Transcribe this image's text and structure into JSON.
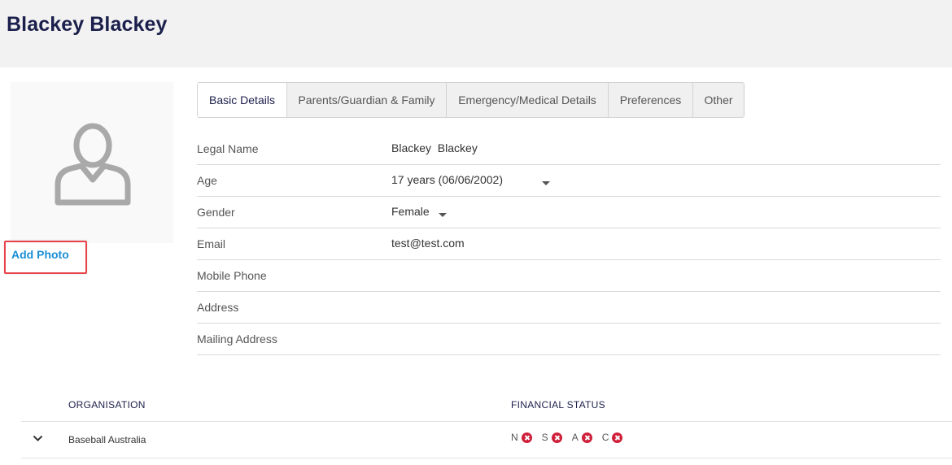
{
  "header": {
    "title": "Blackey Blackey"
  },
  "photo": {
    "add_label": "Add Photo",
    "icon": "user-avatar-icon"
  },
  "tabs": [
    {
      "label": "Basic Details",
      "active": true
    },
    {
      "label": "Parents/Guardian & Family",
      "active": false
    },
    {
      "label": "Emergency/Medical Details",
      "active": false
    },
    {
      "label": "Preferences",
      "active": false
    },
    {
      "label": "Other",
      "active": false
    }
  ],
  "details": [
    {
      "label": "Legal Name",
      "value": "Blackey  Blackey"
    },
    {
      "label": "Age",
      "value": "17 years (06/06/2002)"
    },
    {
      "label": "Gender",
      "value": "Female"
    },
    {
      "label": "Email",
      "value": "test@test.com"
    },
    {
      "label": "Mobile Phone",
      "value": ""
    },
    {
      "label": "Address",
      "value": ""
    },
    {
      "label": "Mailing Address",
      "value": ""
    }
  ],
  "org_table": {
    "headers": {
      "organisation": "ORGANISATION",
      "financial_status": "FINANCIAL STATUS"
    },
    "rows": [
      {
        "organisation": "Baseball Australia",
        "status": [
          {
            "letter": "N",
            "state": "unpaid"
          },
          {
            "letter": "S",
            "state": "unpaid"
          },
          {
            "letter": "A",
            "state": "unpaid"
          },
          {
            "letter": "C",
            "state": "unpaid"
          }
        ]
      }
    ]
  },
  "colors": {
    "title": "#1b1f4b",
    "link": "#1a8fd6",
    "highlight": "#e8434a",
    "status_unpaid": "#cf1f3a"
  }
}
